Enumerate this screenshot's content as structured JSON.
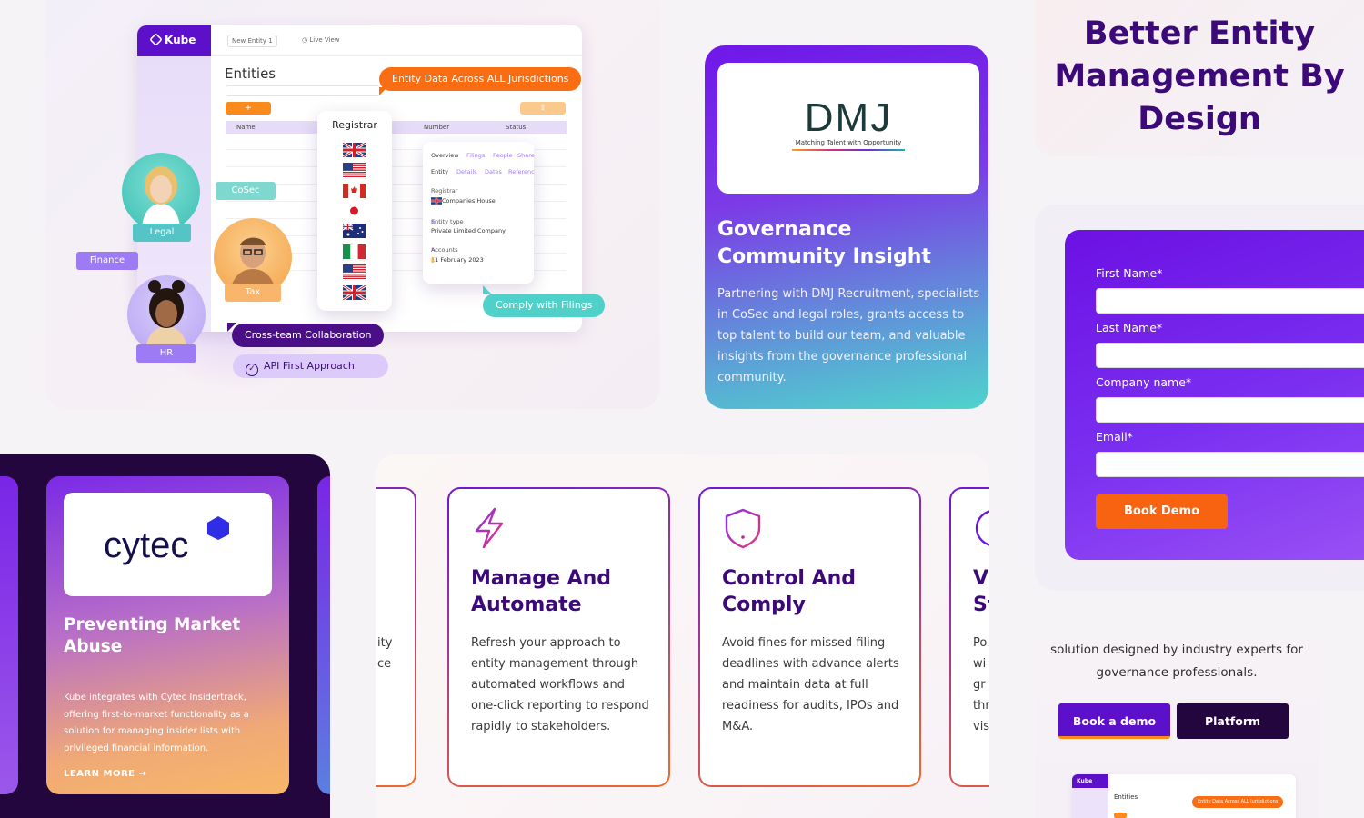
{
  "mockup": {
    "brand": "Kube",
    "new_entity": "New Entity",
    "new_entity_count": "1",
    "live_view": "Live View",
    "entities_title": "Entities",
    "add_symbol": "+",
    "upload_symbol": "⇪",
    "columns": [
      "Name",
      "Number",
      "Status"
    ],
    "registrar_title": "Registrar",
    "registrar_flags": [
      "uk",
      "us",
      "ca",
      "jp",
      "au",
      "it",
      "us",
      "uk"
    ],
    "detail": {
      "tabs_row1": [
        "Overview",
        "Filings",
        "People",
        "Share"
      ],
      "tabs_row2": [
        "Entity",
        "Details",
        "Dates",
        "Referenc"
      ],
      "registrar_label": "Registrar",
      "registrar_value": "Companies House",
      "entity_type_label": "Entity type",
      "entity_type_value": "Private Limited Company",
      "accounts_label": "Accounts",
      "accounts_value": "11 February 2023"
    },
    "callouts": {
      "jurisdictions": "Entity Data Across ALL Jurisdictions",
      "filings": "Comply with Filings",
      "collab": "Cross-team Collaboration",
      "api": "API First Approach"
    },
    "roles": [
      "CoSec",
      "Legal",
      "Finance",
      "Tax",
      "HR"
    ],
    "colors": {
      "brand_purple": "#5d10c9",
      "orange": "#fb8a1c",
      "teal": "#4fd0c8"
    }
  },
  "dmj": {
    "logo_text": "DMJ",
    "logo_tagline": "Matching Talent with Opportunity",
    "title": "Governance Community Insight",
    "body": "Partnering with DMJ Recruitment, specialists in CoSec and legal roles, grants access to top talent to build our team, and valuable insights from the governance professional community."
  },
  "headline": {
    "line1": "Better Entity",
    "line2": "Management By",
    "line3": "Design"
  },
  "form": {
    "first_name": "First Name*",
    "last_name": "Last Name*",
    "company": "Company name*",
    "email": "Email*",
    "submit": "Book Demo"
  },
  "cytec": {
    "logo_text": "cytec",
    "title": "Preventing Market Abuse",
    "body": "Kube integrates with Cytec Insidertrack, offering first-to-market functionality as a solution for managing insider lists with privileged financial information.",
    "cta": "LEARN MORE →"
  },
  "features": {
    "partial_left": [
      "ity",
      "ce"
    ],
    "cards": [
      {
        "icon": "lightning-icon",
        "title": "Manage And Automate",
        "body": "Refresh your approach to entity management through automated workflows and one-click reporting to respond rapidly to stakeholders."
      },
      {
        "icon": "shield-alert-icon",
        "title": "Control And Comply",
        "body": "Avoid fines for missed filing deadlines with advance alerts and maintain data at full readiness for audits, IPOs and M&A."
      }
    ],
    "partial_right_title": [
      "V",
      "St"
    ],
    "partial_right_body": [
      "Po",
      "wi",
      "gr",
      "thr",
      "vis"
    ]
  },
  "cta_block": {
    "text": "solution designed by industry experts for governance professionals.",
    "book_demo": "Book a demo",
    "platform": "Platform",
    "mini_brand": "Kube",
    "mini_title": "Entities",
    "mini_callout": "Entity Data Across ALL Jurisdictions"
  }
}
